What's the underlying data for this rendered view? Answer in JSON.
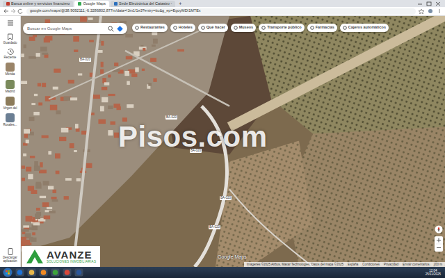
{
  "browser": {
    "tabs": [
      {
        "label": "Banca online y servicios financiero",
        "selected": false
      },
      {
        "label": "Google Maps",
        "selected": true
      },
      {
        "label": "Sede Electrónica del Catastro -",
        "selected": false
      }
    ],
    "new_tab": "+",
    "url": "google.com/maps/@38.9092111,-6.3286802,877m/data=!3m1!1e3?entry=ttu&g_ep=EgoyMDI1MTEx"
  },
  "maps": {
    "rail": [
      {
        "label": "Guardado",
        "kind": "icon"
      },
      {
        "label": "Reciente",
        "kind": "icon"
      },
      {
        "label": "Mérida",
        "kind": "place"
      },
      {
        "label": "Madrid",
        "kind": "place"
      },
      {
        "label": "Virgen del",
        "kind": "place"
      },
      {
        "label": "Rosales...",
        "kind": "place"
      }
    ],
    "download": "Descargar aplicación",
    "search": {
      "placeholder": "Buscar en Google Maps"
    },
    "chips": [
      "Restaurantes",
      "Hoteles",
      "Qué hacer",
      "Museos",
      "Transporte público",
      "Farmacias",
      "Cajeros automáticos"
    ],
    "road_labels": [
      "BA-020",
      "BA-020",
      "BA-020",
      "BA-020",
      "BA-020"
    ],
    "google_label": "Google Maps",
    "attribution": [
      "Imágenes ©2025 Airbus, Maxar Technologies, Datos del mapa ©2025",
      "España",
      "Condiciones",
      "Privacidad",
      "Enviar comentarios",
      "200 m"
    ]
  },
  "watermark": "Pisos.com",
  "logo": {
    "name": "AVANZE",
    "tagline": "SOLUCIONES INMOBILIARIAS"
  },
  "taskbar": {
    "time": "12:04",
    "date": "25/11/2025"
  }
}
